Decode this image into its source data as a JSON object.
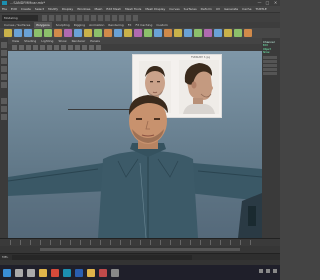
{
  "window": {
    "title": "...SANDFMMcar.mb*",
    "controls": [
      "—",
      "□",
      "✕"
    ]
  },
  "menubar": {
    "items": [
      "File",
      "Edit",
      "Create",
      "Select",
      "Modify",
      "Display",
      "Windows",
      "Mesh",
      "Edit Mesh",
      "Mesh Tools",
      "Mesh Display",
      "Curves",
      "Surfaces",
      "Deform",
      "UV",
      "Generate",
      "Cache",
      "TURTLE"
    ]
  },
  "status_line": {
    "mode_value": "Modeling"
  },
  "shelf": {
    "tabs": [
      "Curves / Surfaces",
      "Polygons",
      "Sculpting",
      "Rigging",
      "Animation",
      "Rendering",
      "FX",
      "FX Caching",
      "Custom"
    ],
    "active_tab": "Polygons",
    "icon_colors": [
      "#c9b24a",
      "#6aa2d6",
      "#6aa2d6",
      "#8cc06b",
      "#8cc06b",
      "#d08a4a",
      "#b06ab0",
      "#6aa2d6",
      "#c9b24a",
      "#8cc06b",
      "#d08a4a",
      "#6aa2d6",
      "#c9b24a",
      "#b06ab0",
      "#8cc06b",
      "#6aa2d6",
      "#d08a4a",
      "#c9b24a",
      "#6aa2d6",
      "#8cc06b",
      "#b06ab0",
      "#6aa2d6",
      "#c9b24a",
      "#8cc06b",
      "#d08a4a"
    ]
  },
  "panel_menu": {
    "items": [
      "View",
      "Shading",
      "Lighting",
      "Show",
      "Renderer",
      "Panels"
    ]
  },
  "reference_image": {
    "label": "FSBNLMH 3.jpg"
  },
  "channel_box": {
    "title": "Channel",
    "lines": [
      "Edit",
      "Object",
      "Show"
    ]
  },
  "command_line": {
    "label": "MEL"
  },
  "colors": {
    "viewport_top": "#7f97a8",
    "viewport_bottom": "#55697a",
    "shirt": "#3a5866",
    "skin": "#c8926e",
    "hair": "#3a2a1c",
    "accent": "#1c8fb0"
  },
  "taskbar": {
    "apps": [
      "windows-icon",
      "search-icon",
      "task-view-icon",
      "file-explorer-icon",
      "chrome-icon",
      "maya-icon",
      "photoshop-icon",
      "folder-icon",
      "media-icon",
      "settings-icon"
    ],
    "app_colors": [
      "#3a8fd6",
      "#aaaaaa",
      "#aaaaaa",
      "#e0b44a",
      "#d64a3a",
      "#1c8fb0",
      "#2a5fb0",
      "#e0b44a",
      "#c04a4a",
      "#888888"
    ]
  }
}
